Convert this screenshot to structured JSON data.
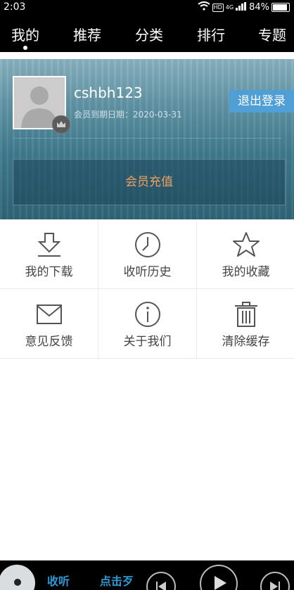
{
  "status_bar": {
    "time": "2:03",
    "network_hd": "HD",
    "signal_label": "4G",
    "battery": "84%"
  },
  "nav": {
    "tabs": [
      {
        "label": "我的"
      },
      {
        "label": "推荐"
      },
      {
        "label": "分类"
      },
      {
        "label": "排行"
      },
      {
        "label": "专题"
      }
    ]
  },
  "profile": {
    "username": "cshbh123",
    "expiry": "会员到期日期：2020-03-31",
    "logout_label": "退出登录",
    "recharge_label": "会员充值"
  },
  "grid": {
    "items": [
      {
        "label": "我的下载",
        "icon": "download-icon"
      },
      {
        "label": "收听历史",
        "icon": "clock-icon"
      },
      {
        "label": "我的收藏",
        "icon": "star-icon"
      },
      {
        "label": "意见反馈",
        "icon": "mail-icon"
      },
      {
        "label": "关于我们",
        "icon": "info-icon"
      },
      {
        "label": "清除缓存",
        "icon": "trash-icon"
      }
    ]
  },
  "player": {
    "text_1": "收听",
    "text_2": "点击歹",
    "buttons": [
      "previous-icon",
      "play-icon",
      "next-icon"
    ]
  },
  "colors": {
    "logout_bg": "#4f9fd6",
    "recharge_text": "#f0a060",
    "player_text": "#2a9ad6"
  }
}
